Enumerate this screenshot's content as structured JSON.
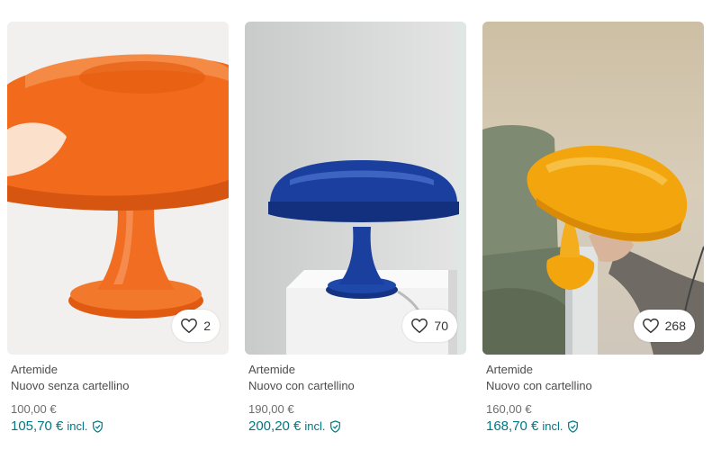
{
  "accent_color": "#007782",
  "items": [
    {
      "brand": "Artemide",
      "condition": "Nuovo senza cartellino",
      "price": "100,00 €",
      "total": "105,70 €",
      "incl_label": "incl.",
      "favourites": "2",
      "lamp_color": "#f26b1d",
      "icons": [
        "heart-icon",
        "shield-check-icon"
      ]
    },
    {
      "brand": "Artemide",
      "condition": "Nuovo con cartellino",
      "price": "190,00 €",
      "total": "200,20 €",
      "incl_label": "incl.",
      "favourites": "70",
      "lamp_color": "#1a3f9e",
      "icons": [
        "heart-icon",
        "shield-check-icon"
      ]
    },
    {
      "brand": "Artemide",
      "condition": "Nuovo con cartellino",
      "price": "160,00 €",
      "total": "168,70 €",
      "incl_label": "incl.",
      "favourites": "268",
      "lamp_color": "#f2a50c",
      "icons": [
        "heart-icon",
        "shield-check-icon"
      ]
    }
  ]
}
